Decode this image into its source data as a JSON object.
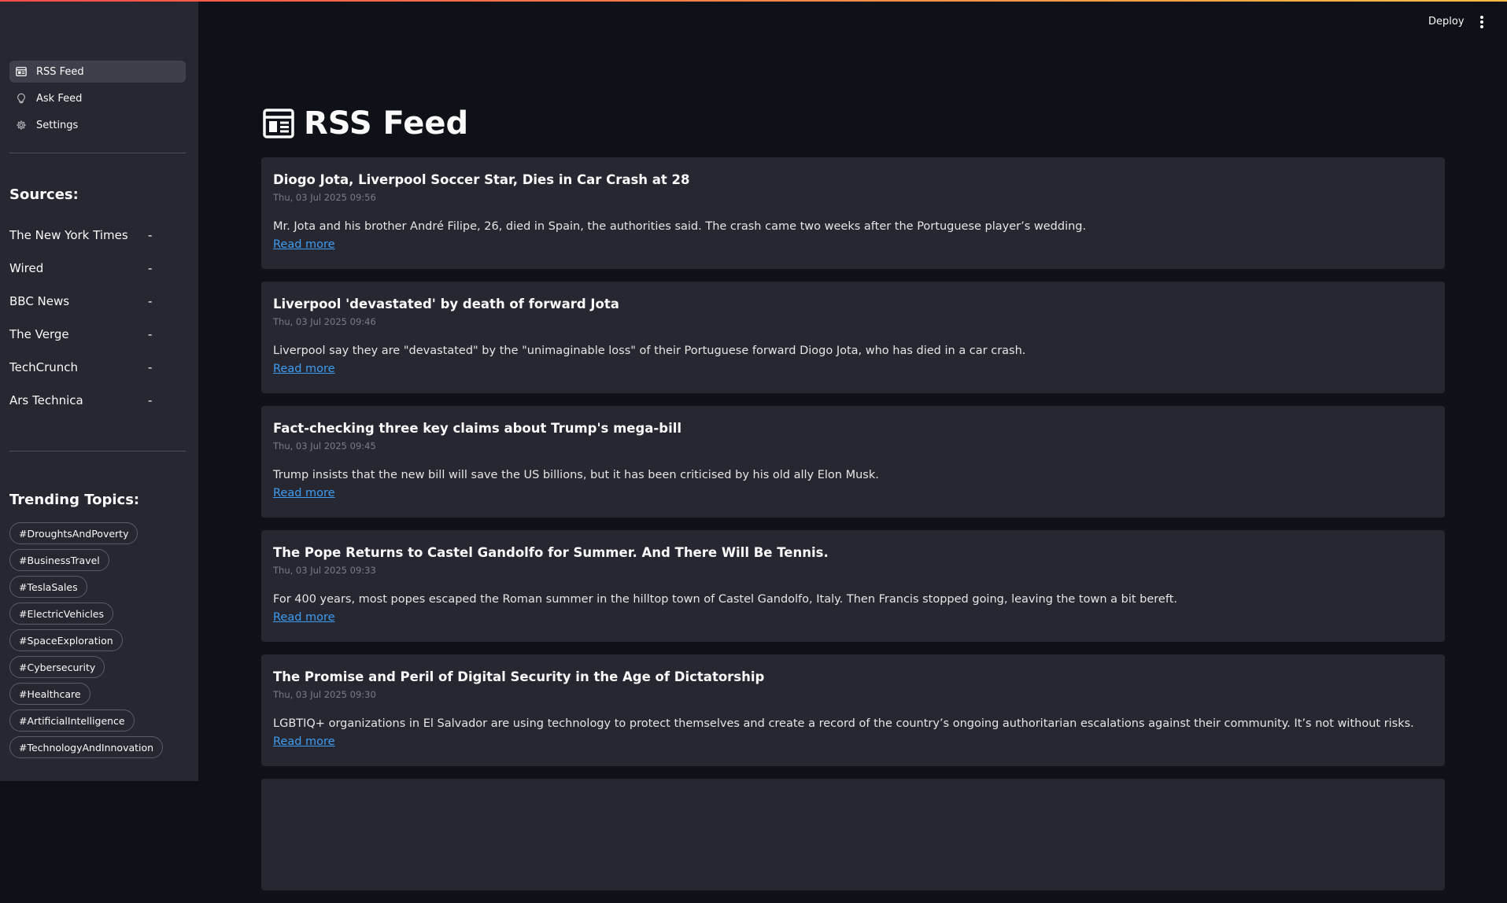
{
  "header": {
    "deploy_label": "Deploy"
  },
  "sidebar": {
    "nav": [
      {
        "label": "RSS Feed",
        "icon": "rss-feed-icon"
      },
      {
        "label": "Ask Feed",
        "icon": "ask-icon"
      },
      {
        "label": "Settings",
        "icon": "gear-icon"
      }
    ],
    "sources_heading": "Sources:",
    "sources": [
      {
        "name": "The New York Times",
        "value": "-"
      },
      {
        "name": "Wired",
        "value": "-"
      },
      {
        "name": "BBC News",
        "value": "-"
      },
      {
        "name": "The Verge",
        "value": "-"
      },
      {
        "name": "TechCrunch",
        "value": "-"
      },
      {
        "name": "Ars Technica",
        "value": "-"
      }
    ],
    "trending_heading": "Trending Topics:",
    "tags": [
      "#DroughtsAndPoverty",
      "#BusinessTravel",
      "#TeslaSales",
      "#ElectricVehicles",
      "#SpaceExploration",
      "#Cybersecurity",
      "#Healthcare",
      "#ArtificialIntelligence",
      "#TechnologyAndInnovation"
    ]
  },
  "main": {
    "title": "RSS Feed",
    "read_more": "Read more",
    "articles": [
      {
        "title": "Diogo Jota, Liverpool Soccer Star, Dies in Car Crash at 28",
        "date": "Thu, 03 Jul 2025 09:56",
        "summary": "Mr. Jota and his brother André Filipe, 26, died in Spain, the authorities said. The crash came two weeks after the Portuguese player’s wedding."
      },
      {
        "title": "Liverpool 'devastated' by death of forward Jota",
        "date": "Thu, 03 Jul 2025 09:46",
        "summary": "Liverpool say they are \"devastated\" by the \"unimaginable loss\" of their Portuguese forward Diogo Jota, who has died in a car crash."
      },
      {
        "title": "Fact-checking three key claims about Trump's mega-bill",
        "date": "Thu, 03 Jul 2025 09:45",
        "summary": "Trump insists that the new bill will save the US billions, but it has been criticised by his old ally Elon Musk."
      },
      {
        "title": "The Pope Returns to Castel Gandolfo for Summer. And There Will Be Tennis.",
        "date": "Thu, 03 Jul 2025 09:33",
        "summary": "For 400 years, most popes escaped the Roman summer in the hilltop town of Castel Gandolfo, Italy. Then Francis stopped going, leaving the town a bit bereft."
      },
      {
        "title": "The Promise and Peril of Digital Security in the Age of Dictatorship",
        "date": "Thu, 03 Jul 2025 09:30",
        "summary": "LGBTIQ+ organizations in El Salvador are using technology to protect themselves and create a record of the country’s ongoing authoritarian escalations against their community. It’s not without risks."
      }
    ]
  },
  "colors": {
    "background": "#0e1117",
    "sidebar": "#262730",
    "card": "#262730",
    "link": "#3d9df3",
    "accent_gradient_start": "#ff4b4b",
    "accent_gradient_end": "#ffbd45"
  }
}
